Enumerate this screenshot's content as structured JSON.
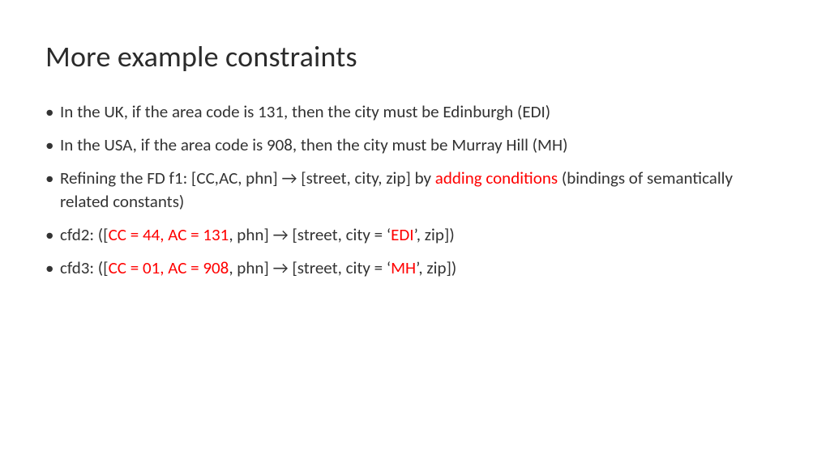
{
  "title": "More example constraints",
  "bullets": {
    "b1": "In the UK, if the area code is 131, then the city must be Edinburgh (EDI)",
    "b2": "In the USA, if the area code is 908, then the city must be Murray Hill (MH)",
    "b3a": "Refining the FD f1: [CC,AC, phn] → [street, city, zip] by ",
    "b3b": "adding conditions",
    "b3c": " (bindings of semantically related constants)",
    "b4a": "cfd2: ([",
    "b4b": "CC = 44, AC = 131",
    "b4c": ", phn] → [street, city = ‘",
    "b4d": "EDI",
    "b4e": "’, zip])",
    "b5a": "cfd3: ([",
    "b5b": "CC = 01, AC = 908",
    "b5c": ", phn] → [street, city = ‘",
    "b5d": "MH",
    "b5e": "’, zip])"
  }
}
